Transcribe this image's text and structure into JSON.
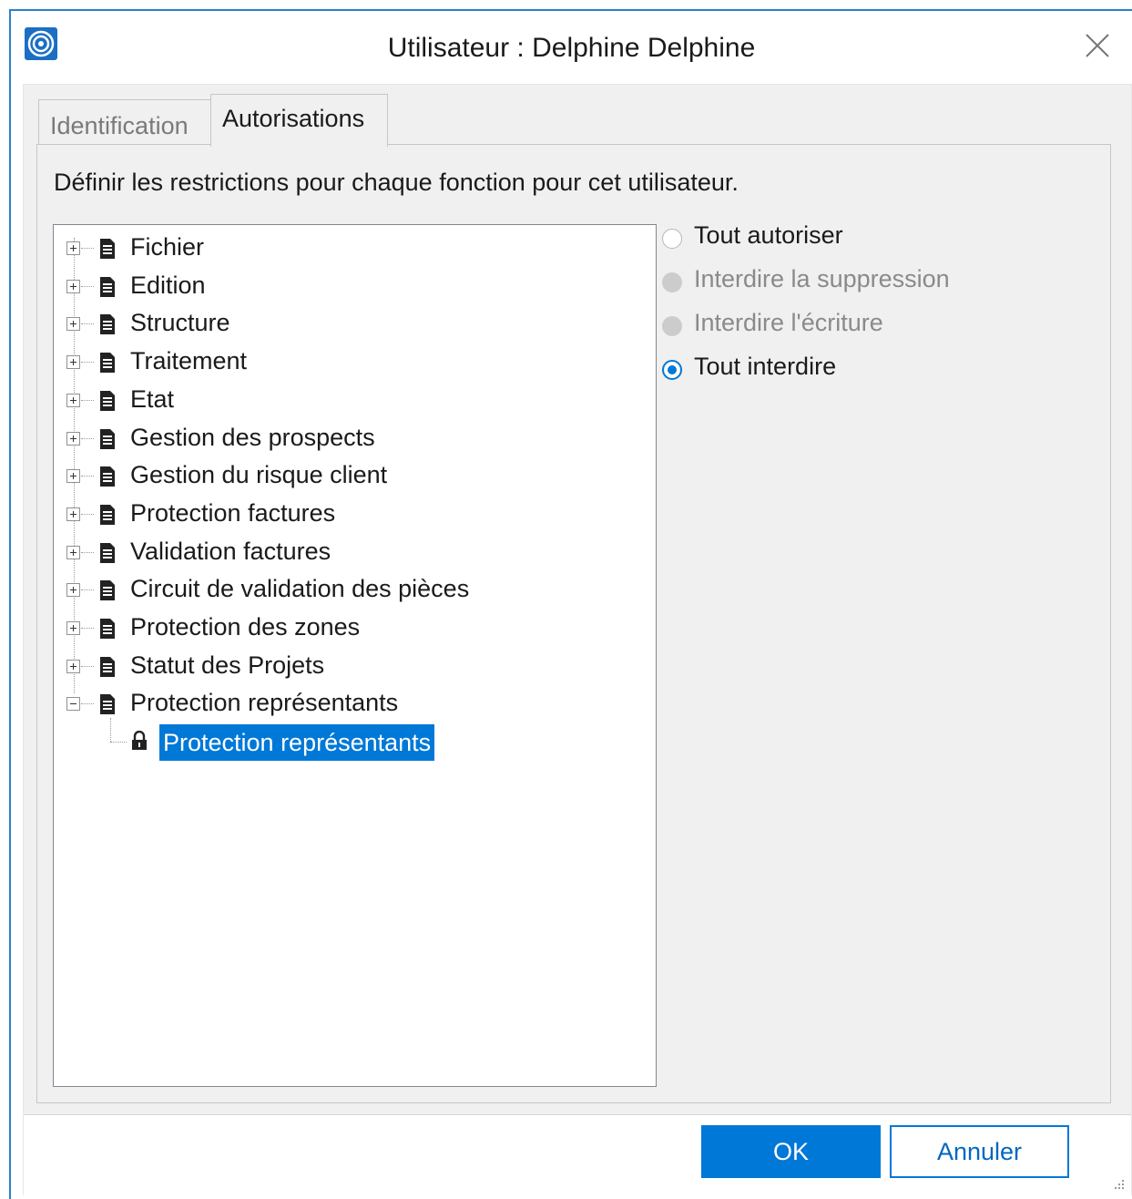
{
  "window": {
    "title": "Utilisateur : Delphine Delphine",
    "accent": "#0078d7"
  },
  "tabs": [
    {
      "label": "Identification",
      "active": false
    },
    {
      "label": "Autorisations",
      "active": true
    }
  ],
  "description": "Définir les restrictions pour chaque fonction pour cet utilisateur.",
  "tree": {
    "items": [
      {
        "label": "Fichier",
        "expanded": false
      },
      {
        "label": "Edition",
        "expanded": false
      },
      {
        "label": "Structure",
        "expanded": false
      },
      {
        "label": "Traitement",
        "expanded": false
      },
      {
        "label": "Etat",
        "expanded": false
      },
      {
        "label": "Gestion des prospects",
        "expanded": false
      },
      {
        "label": "Gestion du risque client",
        "expanded": false
      },
      {
        "label": "Protection factures",
        "expanded": false
      },
      {
        "label": "Validation factures",
        "expanded": false
      },
      {
        "label": "Circuit de validation des pièces",
        "expanded": false
      },
      {
        "label": "Protection des zones",
        "expanded": false
      },
      {
        "label": "Statut des Projets",
        "expanded": false
      },
      {
        "label": "Protection représentants",
        "expanded": true
      }
    ],
    "selected_child": {
      "label": "Protection représentants",
      "icon": "lock-icon"
    }
  },
  "permissions": {
    "options": [
      {
        "label": "Tout autoriser",
        "state": "unchecked"
      },
      {
        "label": "Interdire la suppression",
        "state": "disabled"
      },
      {
        "label": "Interdire l'écriture",
        "state": "disabled"
      },
      {
        "label": "Tout interdire",
        "state": "checked"
      }
    ]
  },
  "buttons": {
    "ok": "OK",
    "cancel": "Annuler"
  }
}
